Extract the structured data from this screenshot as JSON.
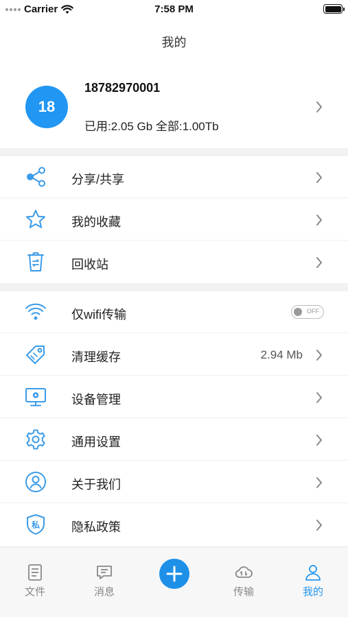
{
  "status_bar": {
    "carrier": "Carrier",
    "time": "7:58 PM"
  },
  "nav": {
    "title": "我的"
  },
  "profile": {
    "avatar_text": "18",
    "phone": "18782970001",
    "storage": "已用:2.05 Gb 全部:1.00Tb"
  },
  "menu_group1": [
    {
      "icon": "share-icon",
      "label": "分享/共享"
    },
    {
      "icon": "star-icon",
      "label": "我的收藏"
    },
    {
      "icon": "recycle-bin-icon",
      "label": "回收站"
    }
  ],
  "menu_group2": {
    "wifi_only": {
      "icon": "wifi-icon",
      "label": "仅wifi传输",
      "toggle_text": "OFF"
    },
    "clear_cache": {
      "icon": "tag-icon",
      "label": "清理缓存",
      "value": "2.94 Mb"
    },
    "device_manage": {
      "icon": "monitor-gear-icon",
      "label": "设备管理"
    },
    "general_settings": {
      "icon": "gear-icon",
      "label": "通用设置"
    },
    "about_us": {
      "icon": "person-circle-icon",
      "label": "关于我们"
    },
    "privacy_policy": {
      "icon": "privacy-shield-icon",
      "label": "隐私政策",
      "icon_text": "私"
    }
  },
  "tabbar": {
    "files": "文件",
    "messages": "消息",
    "transfer": "传输",
    "mine": "我的"
  },
  "colors": {
    "accent": "#2196f3",
    "icon": "#3a9be8",
    "text": "#222222",
    "inactive": "#888888"
  }
}
